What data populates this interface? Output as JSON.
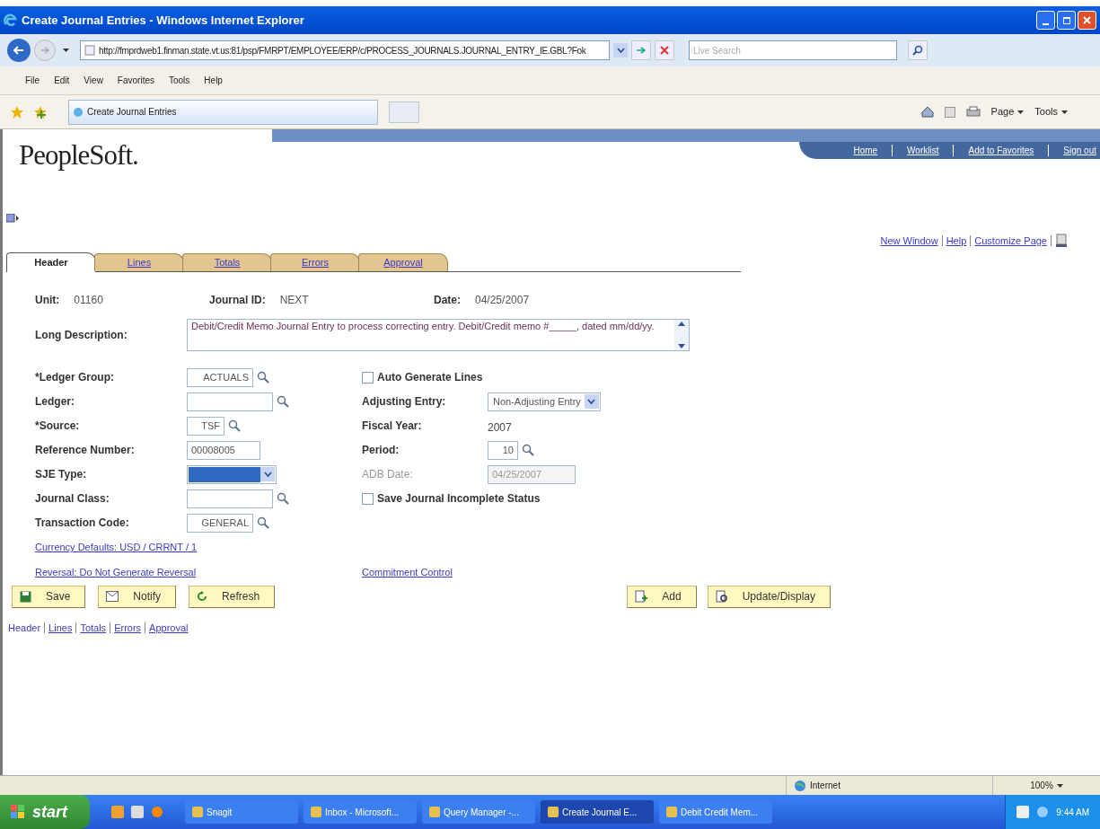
{
  "window": {
    "title": "Create Journal Entries - Windows Internet Explorer"
  },
  "address_bar": {
    "url": "http://fmprdweb1.finman.state.vt.us:81/psp/FMRPT/EMPLOYEE/ERP/c/PROCESS_JOURNALS.JOURNAL_ENTRY_IE.GBL?Fok",
    "search_placeholder": "Live Search"
  },
  "menu": [
    "File",
    "Edit",
    "View",
    "Favorites",
    "Tools",
    "Help"
  ],
  "browser_tab": {
    "title": "Create Journal Entries"
  },
  "command_bar": [
    "Page",
    "Tools"
  ],
  "logo": "PeopleSoft.",
  "header_links": [
    "Home",
    "Worklist",
    "Add to Favorites",
    "Sign out"
  ],
  "page_links": [
    "New Window",
    "Help",
    "Customize Page"
  ],
  "tabs": [
    {
      "label": "Header",
      "selected": true
    },
    {
      "label": "Lines",
      "selected": false
    },
    {
      "label": "Totals",
      "selected": false
    },
    {
      "label": "Errors",
      "selected": false
    },
    {
      "label": "Approval",
      "selected": false
    }
  ],
  "summary": [
    {
      "label": "Unit:",
      "value": "01160"
    },
    {
      "label": "Journal ID:",
      "value": "NEXT"
    },
    {
      "label": "Date:",
      "value": "04/25/2007"
    }
  ],
  "long_description": {
    "label": "Long Description:",
    "value": "Debit/Credit Memo Journal Entry to process correcting entry. Debit/Credit memo #_____, dated mm/dd/yy."
  },
  "rows": [
    {
      "left": {
        "kind": "lookup",
        "label": "*Ledger Group:",
        "value": "ACTUALS"
      },
      "right": {
        "kind": "checkbox",
        "label": "Auto Generate Lines",
        "checked": false
      }
    },
    {
      "left": {
        "kind": "lookup",
        "label": "Ledger:"
      },
      "right": {
        "kind": "select",
        "label": "Adjusting Entry:",
        "value": "Non-Adjusting Entry"
      }
    },
    {
      "left": {
        "kind": "lookup",
        "label": "*Source:",
        "value": "TSF"
      },
      "right": {
        "kind": "text",
        "label": "Fiscal Year:",
        "value": "2007"
      }
    },
    {
      "left": {
        "kind": "input",
        "label": "Reference Number:",
        "value": "00008005"
      },
      "right": {
        "kind": "lookup",
        "label": "Period:",
        "value": "10"
      }
    },
    {
      "left": {
        "kind": "select",
        "label": "SJE Type:",
        "focused": true
      },
      "right": {
        "kind": "input",
        "label": "ADB Date:",
        "value": "04/25/2007",
        "disabled": true
      }
    },
    {
      "left": {
        "kind": "lookup",
        "label": "Journal Class:"
      },
      "right": {
        "kind": "checkbox",
        "label": "Save Journal Incomplete Status",
        "checked": false
      }
    },
    {
      "left": {
        "kind": "lookup",
        "label": "Transaction Code:",
        "value": "GENERAL"
      }
    }
  ],
  "links": {
    "currency": "Currency Defaults: USD / CRRNT / 1",
    "reversal": "Reversal: Do Not Generate Reversal",
    "commitment": "Commitment Control"
  },
  "buttons_left": [
    {
      "kind": "save",
      "label": "Save"
    },
    {
      "kind": "notify",
      "label": "Notify"
    },
    {
      "kind": "refresh",
      "label": "Refresh"
    }
  ],
  "buttons_right": [
    {
      "kind": "add",
      "label": "Add"
    },
    {
      "kind": "update",
      "label": "Update/Display"
    }
  ],
  "bottom_links": [
    {
      "label": "Header",
      "selected": true
    },
    {
      "label": "Lines",
      "selected": false
    },
    {
      "label": "Totals",
      "selected": false
    },
    {
      "label": "Errors",
      "selected": false
    },
    {
      "label": "Approval",
      "selected": false
    }
  ],
  "status_bar": {
    "zone": "Internet",
    "zoom": "100%"
  },
  "taskbar": {
    "start": "start",
    "items": [
      {
        "label": "Snagit",
        "selected": false
      },
      {
        "label": "Inbox - Microsoft...",
        "selected": false
      },
      {
        "label": "Query Manager -...",
        "selected": false
      },
      {
        "label": "Create Journal E...",
        "selected": true
      },
      {
        "label": "Debit Credit Mem...",
        "selected": false
      }
    ],
    "clock": "9:44 AM"
  }
}
